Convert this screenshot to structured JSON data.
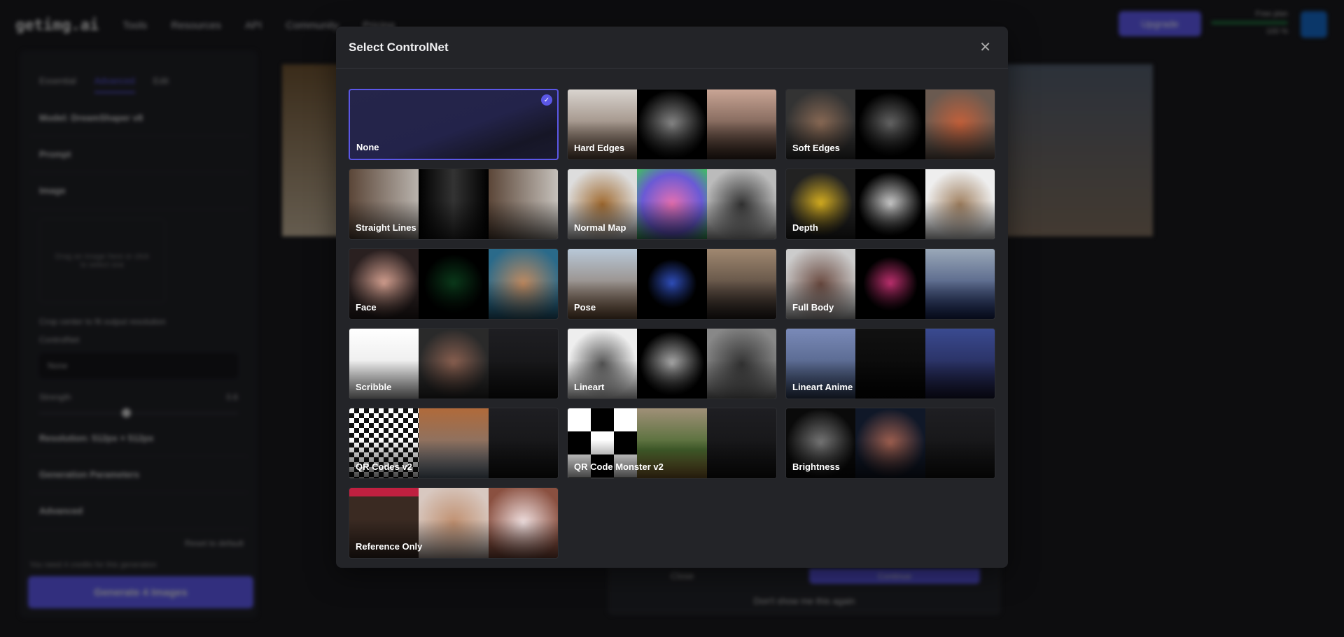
{
  "background": {
    "logo": "getimg.ai",
    "nav": [
      "Tools",
      "Resources",
      "API",
      "Community",
      "Pricing"
    ],
    "upgrade": "Upgrade",
    "plan": "Free plan",
    "plan_credits": "100 %",
    "tabs": [
      "Essential",
      "Advanced",
      "Edit"
    ],
    "model": "Model: DreamShaper v8",
    "prompt": "Prompt",
    "image": "Image",
    "dropzone": "Drag an image here or click to select one",
    "crop": "Crop center to fit output resolution",
    "controlnet_label": "ControlNet",
    "controlnet_value": "None",
    "strength": "Strength",
    "strength_value": "0.6",
    "resolution": "Resolution: 512px × 512px",
    "generation_parameters": "Generation Parameters",
    "advanced": "Advanced",
    "reset": "Reset to default",
    "credits_note": "You need 4 credits for this generation",
    "generate": "Generate 4 Images",
    "dialog_close": "Close",
    "dialog_continue": "Continue",
    "dialog_dont_show": "Don't show me this again"
  },
  "modal": {
    "title": "Select ControlNet",
    "accent": "#5b57e6",
    "options": [
      {
        "label": "None",
        "selected": true,
        "tones": []
      },
      {
        "label": "Hard Edges",
        "tones": [
          "linear-gradient(#d9d4cf,#6b5444)",
          "radial-gradient(#888,#000 70%)",
          "linear-gradient(#c9a595,#3c2a22)"
        ]
      },
      {
        "label": "Soft Edges",
        "tones": [
          "radial-gradient(#8a6a55,#333 70%)",
          "radial-gradient(#666,#000 65%)",
          "radial-gradient(#c4603a,#6a5a50 75%)"
        ]
      },
      {
        "label": "Straight Lines",
        "tones": [
          "linear-gradient(90deg,#5b4638,#b9b3ad)",
          "linear-gradient(90deg,#000,#333,#000)",
          "linear-gradient(90deg,#5b4638,#c5c0ba)"
        ]
      },
      {
        "label": "Normal Map",
        "tones": [
          "radial-gradient(#a06a30,#ddd 75%)",
          "radial-gradient(#e76fb0,#6a5ad5 60%,#3fbf5f)",
          "radial-gradient(#333,#bbb 75%)"
        ]
      },
      {
        "label": "Depth",
        "tones": [
          "radial-gradient(#d8b020,#222 65%)",
          "radial-gradient(#ccc,#000 65%)",
          "radial-gradient(#a08060,#eee 70%)"
        ]
      },
      {
        "label": "Face",
        "tones": [
          "radial-gradient(#d4a090,#2a2020 70%)",
          "radial-gradient(#0a3a1a,#000 60%)",
          "radial-gradient(#c08a60,#2a6a8a 80%)"
        ]
      },
      {
        "label": "Pose",
        "tones": [
          "linear-gradient(#b8c8d8,#7a5a40)",
          "radial-gradient(#3050c0,#000 50%)",
          "linear-gradient(#a08870,#2a2220)"
        ]
      },
      {
        "label": "Full Body",
        "tones": [
          "radial-gradient(#6a4a40,#ccc 80%)",
          "radial-gradient(#c03070,#000 55%)",
          "linear-gradient(#9aa8b8,#1a2a60)"
        ]
      },
      {
        "label": "Scribble",
        "tones": [
          "linear-gradient(#fff,#ddd)",
          "radial-gradient(#8a6050,#2a2a2a 70%)",
          "linear-gradient(#1e1e22,#111)"
        ]
      },
      {
        "label": "Lineart",
        "tones": [
          "radial-gradient(#555,#eee 70%)",
          "radial-gradient(#aaa,#000 65%)",
          "radial-gradient(#333,#888 80%)"
        ]
      },
      {
        "label": "Lineart Anime",
        "tones": [
          "linear-gradient(#7a8ab8,#3a4a6a)",
          "linear-gradient(#111,#050505)",
          "linear-gradient(#3a4a90,#1a1a3a)"
        ]
      },
      {
        "label": "QR Codes v2",
        "tones": [
          "repeating-conic-gradient(#111 0 25%,#fff 0 50%) 0 0/14px 14px",
          "linear-gradient(#b06a3a,#6a7a8a)",
          "linear-gradient(#1e1e22,#111)"
        ]
      },
      {
        "label": "QR Code Monster v2",
        "tones": [
          "conic-gradient(#000 0 25%,#fff 0 50%,#000 0 75%,#fff 0) 0 0/66px 66px",
          "linear-gradient(#a09078,#4a6a30 60%,#8a6a30)",
          "linear-gradient(#1e1e22,#111)"
        ]
      },
      {
        "label": "Brightness",
        "tones": [
          "radial-gradient(#777,#0a0a0a 70%)",
          "radial-gradient(#a06050,#101828 70%)",
          "linear-gradient(#1e1e22,#111)"
        ]
      },
      {
        "label": "Reference Only",
        "tones": [
          "linear-gradient(#c02040 0 12%,#3a2a22 12%)",
          "radial-gradient(#c09070,#d8c8c0 80%)",
          "radial-gradient(#f0e0e0,#8a5040 80%)"
        ]
      }
    ]
  }
}
